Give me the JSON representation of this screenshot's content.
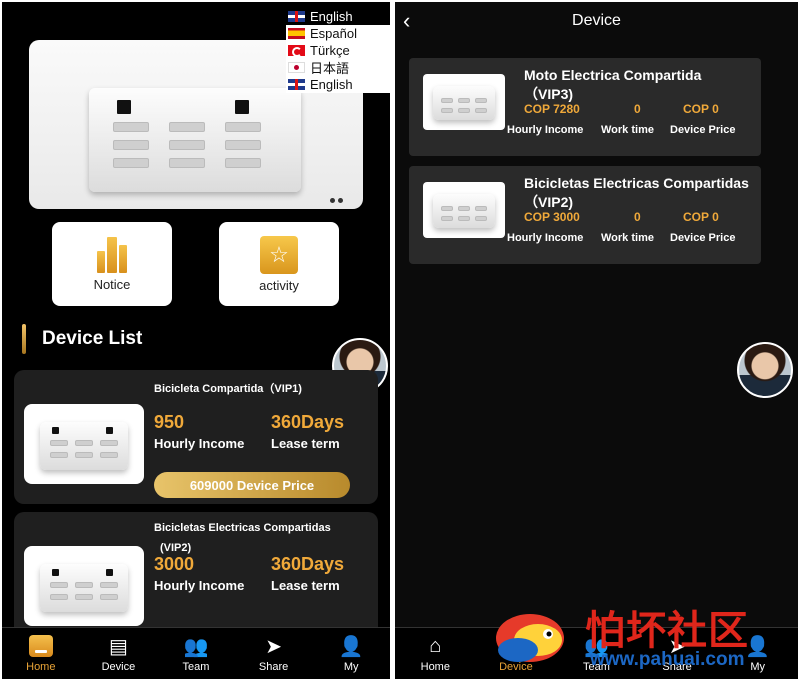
{
  "left": {
    "languages": [
      "English",
      "Español",
      "Türkçe",
      "日本語",
      "English"
    ],
    "quick_buttons": {
      "notice": "Notice",
      "activity": "activity"
    },
    "section_title": "Device List",
    "devices": [
      {
        "name": "Bicicleta Compartida（VIP1)",
        "income": "950",
        "income_label": "Hourly Income",
        "term": "360Days",
        "term_label": "Lease term",
        "price": "609000 Device Price"
      },
      {
        "name": "Bicicletas Electricas Compartidas",
        "name2": "(VIP2)",
        "income": "3000",
        "income_label": "Hourly Income",
        "term": "360Days",
        "term_label": "Lease term"
      }
    ],
    "tabs": [
      "Home",
      "Device",
      "Team",
      "Share",
      "My"
    ]
  },
  "right": {
    "title": "Device",
    "devices": [
      {
        "name": "Moto Electrica Compartida （VIP3)",
        "income": "COP 7280",
        "work": "0",
        "price": "COP 0",
        "income_label": "Hourly Income",
        "work_label": "Work time",
        "price_label": "Device Price"
      },
      {
        "name": "Bicicletas Electricas Compartidas（VIP2)",
        "income": "COP 3000",
        "work": "0",
        "price": "COP 0",
        "income_label": "Hourly Income",
        "work_label": "Work time",
        "price_label": "Device Price"
      }
    ],
    "tabs": [
      "Home",
      "Device",
      "Team",
      "Share",
      "My"
    ]
  },
  "watermark": {
    "text": "怕坏社区",
    "url": "www.pahuai.com"
  },
  "colors": {
    "accent": "#e9a437",
    "card": "#1f1f1f",
    "background": "#000000"
  }
}
